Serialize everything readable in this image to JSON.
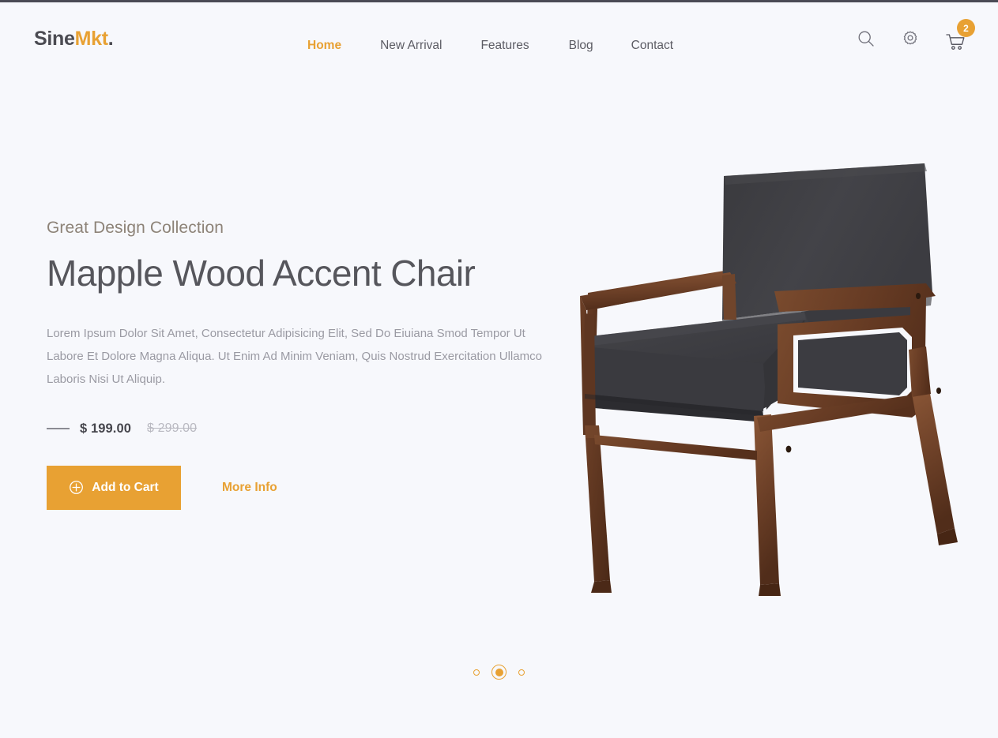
{
  "brand": {
    "name_primary": "Sine",
    "name_accent": "Mkt",
    "name_suffix": ".",
    "accent_color": "#e8a133"
  },
  "nav": {
    "items": [
      {
        "label": "Home",
        "active": true
      },
      {
        "label": "New Arrival",
        "active": false
      },
      {
        "label": "Features",
        "active": false
      },
      {
        "label": "Blog",
        "active": false
      },
      {
        "label": "Contact",
        "active": false
      }
    ]
  },
  "actions": {
    "search_icon": "search-icon",
    "settings_icon": "gear-icon",
    "cart_icon": "shopping-cart-icon",
    "cart_count": "2"
  },
  "hero": {
    "eyebrow": "Great Design Collection",
    "title": "Mapple Wood Accent Chair",
    "description": "Lorem Ipsum Dolor Sit Amet, Consectetur Adipisicing Elit, Sed Do Eiuiana Smod Tempor Ut Labore Et Dolore Magna Aliqua. Ut Enim Ad Minim Veniam, Quis Nostrud Exercitation Ullamco Laboris Nisi Ut Aliquip.",
    "price_current": "$ 199.00",
    "price_original": "$ 299.00",
    "cta_primary": "Add to Cart",
    "cta_primary_icon": "plus-circle-icon",
    "cta_secondary": "More Info",
    "product_image": "maple-wood-accent-chair",
    "upholstery_color": "#3e3e42",
    "wood_color": "#6b4028"
  },
  "carousel": {
    "slides": [
      {
        "index": "1",
        "active": false
      },
      {
        "index": "2",
        "active": true
      },
      {
        "index": "3",
        "active": false
      }
    ]
  },
  "theme": {
    "background": "#f7f8fc",
    "accent": "#e8a133",
    "text_dark": "#56565c",
    "text_muted": "#9a9aa3"
  }
}
